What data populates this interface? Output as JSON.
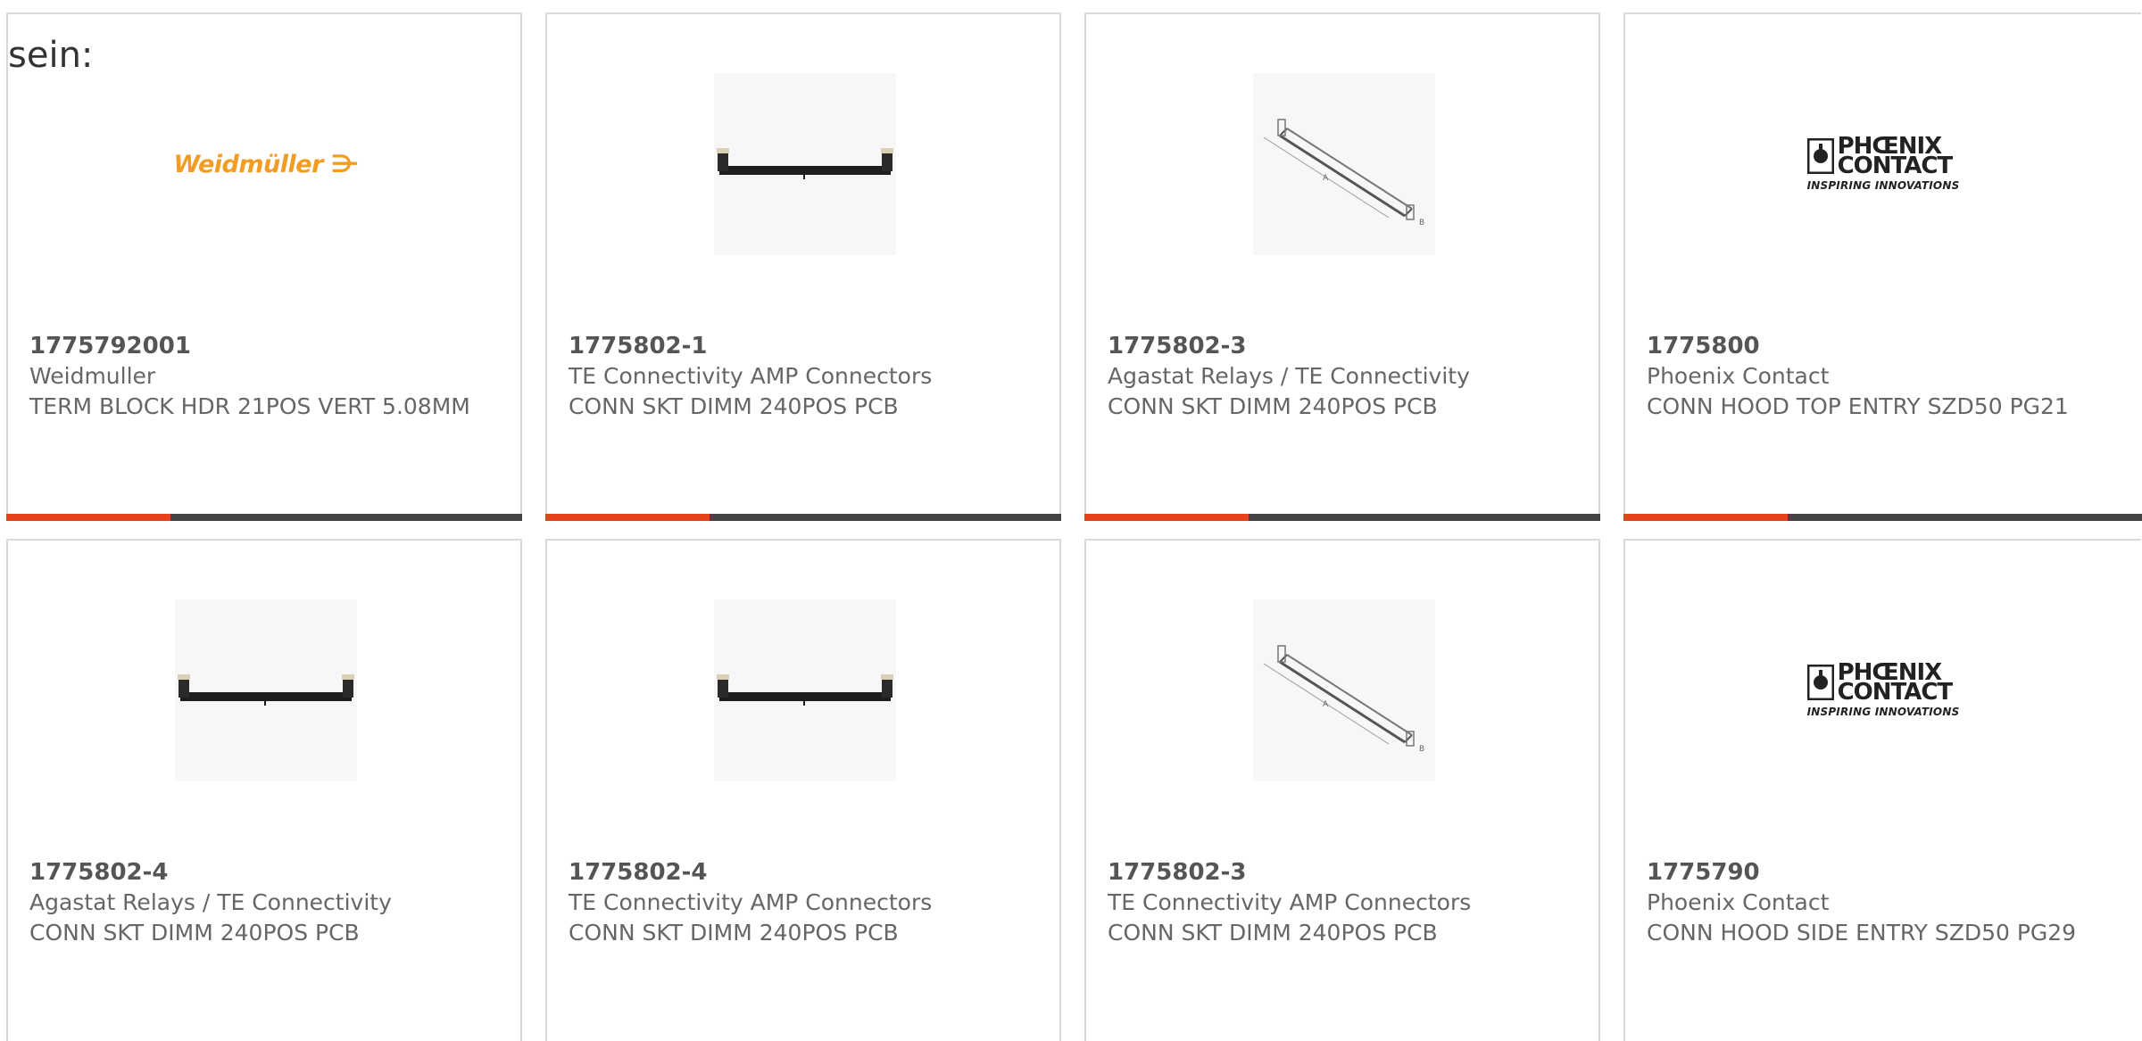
{
  "intro_text": "sein:",
  "brand_colors": {
    "accent": "#e8411e",
    "bar_dark": "#444444",
    "weidmuller": "#f39c24"
  },
  "products": [
    {
      "part_number": "1775792001",
      "manufacturer": "Weidmuller",
      "description": "TERM BLOCK HDR 21POS VERT 5.08MM",
      "image": "weidmuller-logo",
      "logo_text": "Weidmüller"
    },
    {
      "part_number": "1775802-1",
      "manufacturer": "TE Connectivity AMP Connectors",
      "description": "CONN SKT DIMM 240POS PCB",
      "image": "dimm-socket-photo"
    },
    {
      "part_number": "1775802-3",
      "manufacturer": "Agastat Relays / TE Connectivity",
      "description": "CONN SKT DIMM 240POS PCB",
      "image": "dimm-socket-drawing"
    },
    {
      "part_number": "1775800",
      "manufacturer": "Phoenix Contact",
      "description": "CONN HOOD TOP ENTRY SZD50 PG21",
      "image": "phoenix-contact-logo",
      "logo_line1": "PHŒNIX",
      "logo_line2": "CONTACT",
      "logo_tagline": "INSPIRING INNOVATIONS"
    },
    {
      "part_number": "1775802-4",
      "manufacturer": "Agastat Relays / TE Connectivity",
      "description": "CONN SKT DIMM 240POS PCB",
      "image": "dimm-socket-photo"
    },
    {
      "part_number": "1775802-4",
      "manufacturer": "TE Connectivity AMP Connectors",
      "description": "CONN SKT DIMM 240POS PCB",
      "image": "dimm-socket-photo"
    },
    {
      "part_number": "1775802-3",
      "manufacturer": "TE Connectivity AMP Connectors",
      "description": "CONN SKT DIMM 240POS PCB",
      "image": "dimm-socket-drawing"
    },
    {
      "part_number": "1775790",
      "manufacturer": "Phoenix Contact",
      "description": "CONN HOOD SIDE ENTRY SZD50 PG29",
      "image": "phoenix-contact-logo",
      "logo_line1": "PHŒNIX",
      "logo_line2": "CONTACT",
      "logo_tagline": "INSPIRING INNOVATIONS"
    }
  ]
}
